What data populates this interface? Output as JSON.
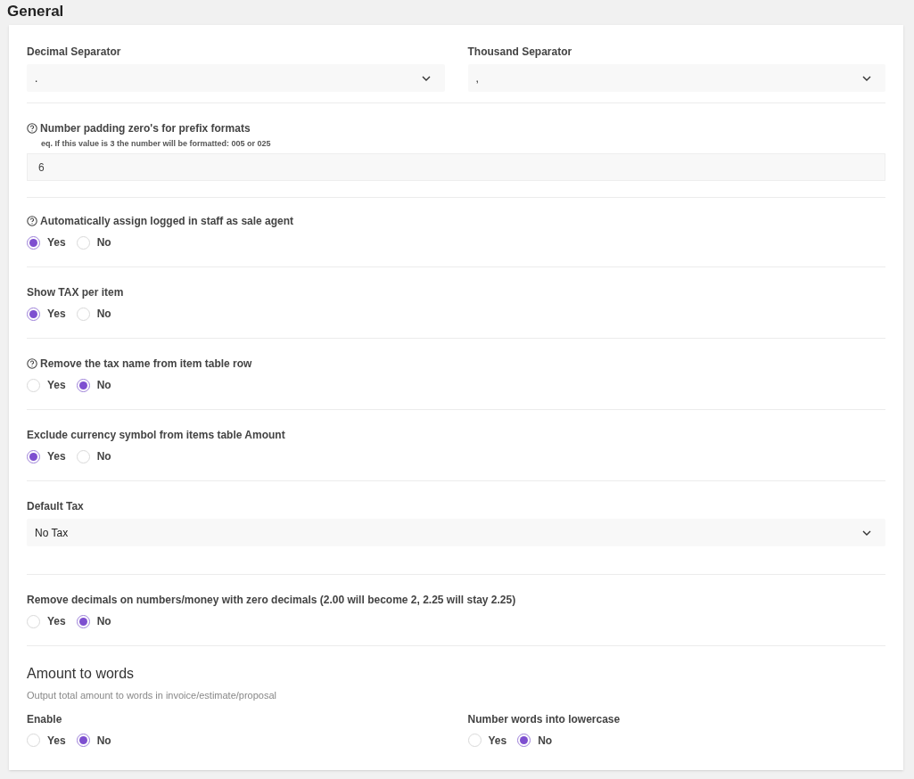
{
  "title": "General",
  "sections": [
    {
      "kind": "select_pair",
      "fields": [
        {
          "label": "Decimal Separator",
          "value": "."
        },
        {
          "label": "Thousand Separator",
          "value": ","
        }
      ]
    },
    {
      "kind": "number",
      "label": "Number padding zero's for prefix formats",
      "help": true,
      "hint": "eq. If this value is 3 the number will be formatted: 005 or 025",
      "value": "6"
    },
    {
      "kind": "radio",
      "label": "Automatically assign logged in staff as sale agent",
      "help": true,
      "options": [
        {
          "label": "Yes",
          "selected": true
        },
        {
          "label": "No",
          "selected": false
        }
      ]
    },
    {
      "kind": "radio",
      "label": "Show TAX per item",
      "help": false,
      "options": [
        {
          "label": "Yes",
          "selected": true
        },
        {
          "label": "No",
          "selected": false
        }
      ]
    },
    {
      "kind": "radio",
      "label": "Remove the tax name from item table row",
      "help": true,
      "options": [
        {
          "label": "Yes",
          "selected": false
        },
        {
          "label": "No",
          "selected": true
        }
      ]
    },
    {
      "kind": "radio",
      "label": "Exclude currency symbol from items table Amount",
      "help": false,
      "options": [
        {
          "label": "Yes",
          "selected": true
        },
        {
          "label": "No",
          "selected": false
        }
      ]
    },
    {
      "kind": "select",
      "label": "Default Tax",
      "value": "No Tax"
    },
    {
      "kind": "radio",
      "label": "Remove decimals on numbers/money with zero decimals (2.00 will become 2, 2.25 will stay 2.25)",
      "help": false,
      "options": [
        {
          "label": "Yes",
          "selected": false
        },
        {
          "label": "No",
          "selected": true
        }
      ]
    },
    {
      "kind": "heading",
      "title": "Amount to words",
      "description": "Output total amount to words in invoice/estimate/proposal"
    },
    {
      "kind": "radio_pair",
      "fields": [
        {
          "label": "Enable",
          "options": [
            {
              "label": "Yes",
              "selected": false
            },
            {
              "label": "No",
              "selected": true
            }
          ]
        },
        {
          "label": "Number words into lowercase",
          "options": [
            {
              "label": "Yes",
              "selected": false
            },
            {
              "label": "No",
              "selected": true
            }
          ]
        }
      ]
    }
  ]
}
